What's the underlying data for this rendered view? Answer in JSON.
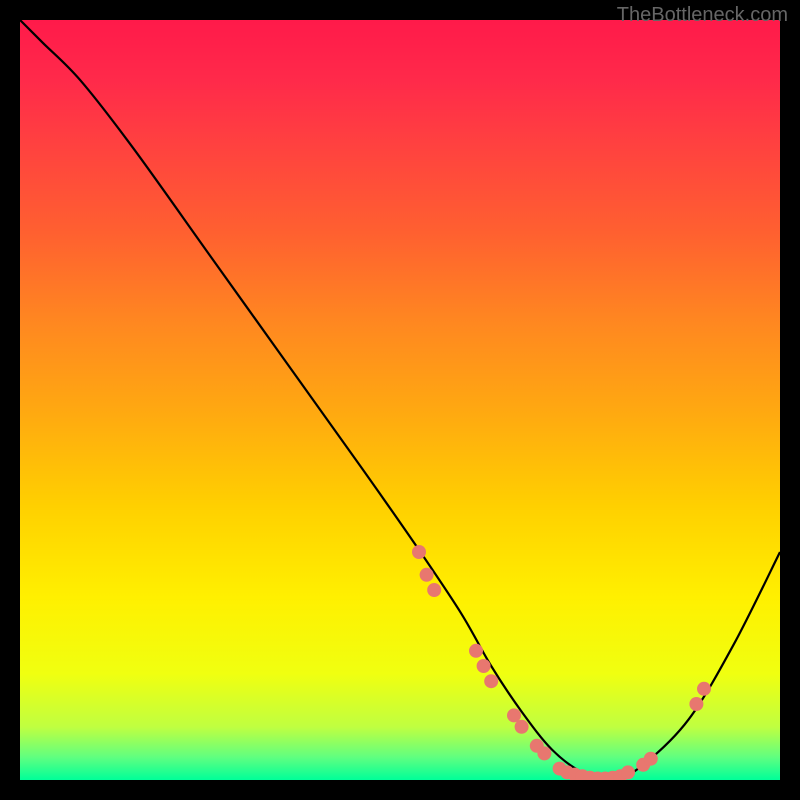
{
  "watermark": "TheBottleneck.com",
  "chart_data": {
    "type": "line",
    "title": "",
    "xlabel": "",
    "ylabel": "",
    "xlim": [
      0,
      100
    ],
    "ylim": [
      0,
      100
    ],
    "curve": {
      "x": [
        0,
        3,
        8,
        15,
        25,
        35,
        45,
        52,
        58,
        62,
        66,
        70,
        74,
        78,
        82,
        88,
        94,
        100
      ],
      "y": [
        100,
        97,
        92,
        83,
        69,
        55,
        41,
        31,
        22,
        15,
        9,
        4,
        1,
        0,
        2,
        8,
        18,
        30
      ]
    },
    "markers": [
      {
        "x": 52.5,
        "y": 30
      },
      {
        "x": 53.5,
        "y": 27
      },
      {
        "x": 54.5,
        "y": 25
      },
      {
        "x": 60,
        "y": 17
      },
      {
        "x": 61,
        "y": 15
      },
      {
        "x": 62,
        "y": 13
      },
      {
        "x": 65,
        "y": 8.5
      },
      {
        "x": 66,
        "y": 7
      },
      {
        "x": 68,
        "y": 4.5
      },
      {
        "x": 69,
        "y": 3.5
      },
      {
        "x": 71,
        "y": 1.5
      },
      {
        "x": 72,
        "y": 1
      },
      {
        "x": 73,
        "y": 0.7
      },
      {
        "x": 74,
        "y": 0.5
      },
      {
        "x": 75,
        "y": 0.3
      },
      {
        "x": 76,
        "y": 0.2
      },
      {
        "x": 77,
        "y": 0.2
      },
      {
        "x": 78,
        "y": 0.3
      },
      {
        "x": 79,
        "y": 0.5
      },
      {
        "x": 80,
        "y": 1
      },
      {
        "x": 82,
        "y": 2
      },
      {
        "x": 83,
        "y": 2.8
      },
      {
        "x": 89,
        "y": 10
      },
      {
        "x": 90,
        "y": 12
      }
    ],
    "marker_color": "#e8776f",
    "marker_radius_px": 7
  }
}
